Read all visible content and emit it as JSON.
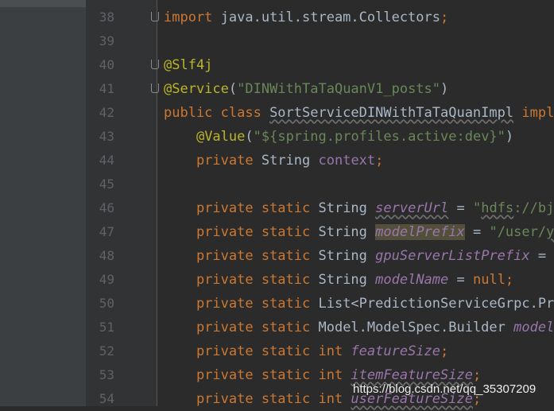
{
  "lines": [
    {
      "num": "38",
      "fold": true,
      "segs": [
        [
          "kw",
          "import"
        ],
        [
          "p",
          " java.util.stream.Collectors"
        ],
        [
          "kw",
          ";"
        ]
      ]
    },
    {
      "num": "39",
      "fold": false,
      "segs": []
    },
    {
      "num": "40",
      "fold": true,
      "segs": [
        [
          "ann",
          "@Slf4j"
        ]
      ]
    },
    {
      "num": "41",
      "fold": true,
      "segs": [
        [
          "ann",
          "@Service"
        ],
        [
          "p",
          "("
        ],
        [
          "str",
          "\"DINWithTaTaQuanV1_posts\""
        ],
        [
          "p",
          ")"
        ]
      ]
    },
    {
      "num": "42",
      "fold": false,
      "segs": [
        [
          "kw",
          "public class "
        ],
        [
          "pw",
          "SortServiceDINWithTaTaQuanImpl"
        ],
        [
          "p",
          " "
        ],
        [
          "kw",
          "imple"
        ]
      ]
    },
    {
      "num": "43",
      "fold": false,
      "segs": [
        [
          "p",
          "    "
        ],
        [
          "ann",
          "@Value"
        ],
        [
          "p",
          "("
        ],
        [
          "str",
          "\"${spring.profiles.active:dev}\""
        ],
        [
          "p",
          ")"
        ]
      ]
    },
    {
      "num": "44",
      "fold": false,
      "segs": [
        [
          "p",
          "    "
        ],
        [
          "kw",
          "private "
        ],
        [
          "p",
          "String "
        ],
        [
          "fp",
          "context"
        ],
        [
          "kw",
          ";"
        ]
      ]
    },
    {
      "num": "45",
      "fold": false,
      "segs": []
    },
    {
      "num": "46",
      "fold": false,
      "segs": [
        [
          "p",
          "    "
        ],
        [
          "kw",
          "private static "
        ],
        [
          "p",
          "String "
        ],
        [
          "fw",
          "serverUrl"
        ],
        [
          "p",
          " = "
        ],
        [
          "str",
          "\""
        ],
        [
          "strw",
          "hdfs"
        ],
        [
          "str",
          "://bjn"
        ]
      ]
    },
    {
      "num": "47",
      "fold": false,
      "segs": [
        [
          "p",
          "    "
        ],
        [
          "kw",
          "private static "
        ],
        [
          "p",
          "String "
        ],
        [
          "fh",
          "modelPrefix"
        ],
        [
          "p",
          " = "
        ],
        [
          "str",
          "\"/user/"
        ],
        [
          "strw",
          "ya"
        ]
      ]
    },
    {
      "num": "48",
      "fold": false,
      "segs": [
        [
          "p",
          "    "
        ],
        [
          "kw",
          "private static "
        ],
        [
          "p",
          "String "
        ],
        [
          "f",
          "gpuServerListPrefix"
        ],
        [
          "p",
          " = "
        ],
        [
          "str",
          "\""
        ]
      ]
    },
    {
      "num": "49",
      "fold": false,
      "segs": [
        [
          "p",
          "    "
        ],
        [
          "kw",
          "private static "
        ],
        [
          "p",
          "String "
        ],
        [
          "f",
          "modelName"
        ],
        [
          "p",
          " = "
        ],
        [
          "kw",
          "null;"
        ]
      ]
    },
    {
      "num": "50",
      "fold": false,
      "segs": [
        [
          "p",
          "    "
        ],
        [
          "kw",
          "private static "
        ],
        [
          "p",
          "List<PredictionServiceGrpc.Pre"
        ]
      ]
    },
    {
      "num": "51",
      "fold": false,
      "segs": [
        [
          "p",
          "    "
        ],
        [
          "kw",
          "private static "
        ],
        [
          "p",
          "Model.ModelSpec.Builder "
        ],
        [
          "f",
          "modelS"
        ]
      ]
    },
    {
      "num": "52",
      "fold": false,
      "segs": [
        [
          "p",
          "    "
        ],
        [
          "kw",
          "private static int "
        ],
        [
          "f",
          "featureSize"
        ],
        [
          "kw",
          ";"
        ]
      ]
    },
    {
      "num": "53",
      "fold": false,
      "segs": [
        [
          "p",
          "    "
        ],
        [
          "kw",
          "private static int "
        ],
        [
          "fw",
          "itemFeatureSize"
        ],
        [
          "kw",
          ";"
        ]
      ]
    },
    {
      "num": "54",
      "fold": false,
      "segs": [
        [
          "p",
          "    "
        ],
        [
          "kw",
          "private static int "
        ],
        [
          "fw",
          "userFeatureSize"
        ],
        [
          "kw",
          ";"
        ]
      ]
    }
  ],
  "colors": {
    "keyword": "#cc7832",
    "annotation": "#bbb529",
    "string": "#6a8759",
    "field": "#9876aa",
    "plain": "#a9b7c6",
    "background": "#2b2b2b"
  },
  "watermark": "https://blog.csdn.net/qq_35307209"
}
